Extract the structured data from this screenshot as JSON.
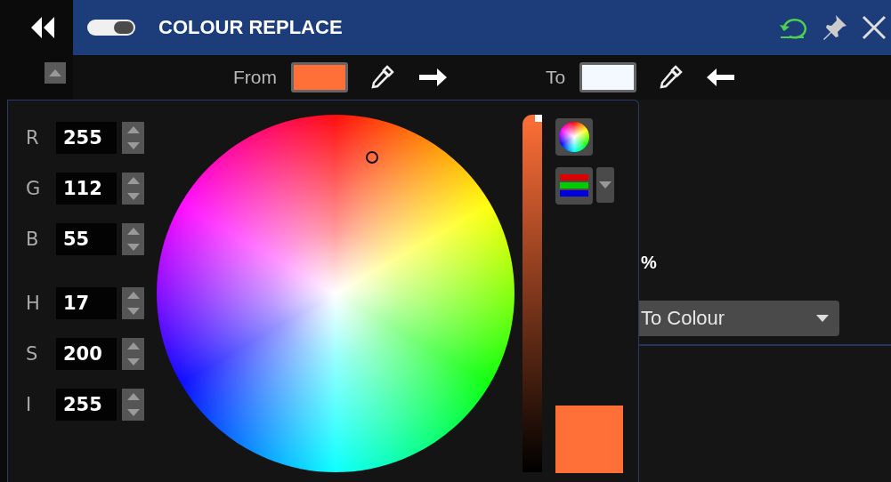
{
  "header": {
    "toggle": {
      "on": true
    },
    "title": "COLOUR REPLACE"
  },
  "toolbar": {
    "from": {
      "label": "From",
      "color": "#ff6f37"
    },
    "to": {
      "label": "To",
      "color": "#f4f8ff"
    }
  },
  "picker": {
    "channels": [
      {
        "label": "R",
        "value": "255"
      },
      {
        "label": "G",
        "value": "112"
      },
      {
        "label": "B",
        "value": "55"
      },
      {
        "label": "H",
        "value": "17"
      },
      {
        "label": "S",
        "value": "200"
      },
      {
        "label": "I",
        "value": "255"
      }
    ],
    "intensity_slider": {
      "level": 1
    },
    "preview": {
      "color": "#ff6f37"
    }
  },
  "settings": {
    "percent_text": "%",
    "mode_dropdown": "To Colour"
  }
}
